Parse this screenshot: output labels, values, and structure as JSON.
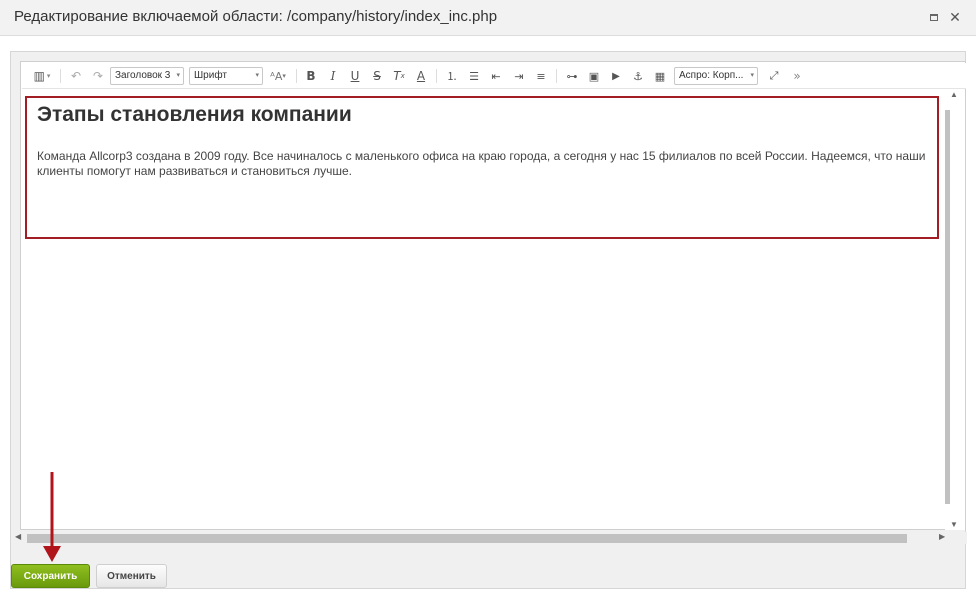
{
  "dialog": {
    "title": "Редактирование включаемой области: /company/history/index_inc.php"
  },
  "toolbar": {
    "format_select": "Заголовок 3",
    "font_select": "Шрифт",
    "style_select": "Аспро: Корп...",
    "icons": [
      "view-mode-icon",
      "undo-icon",
      "redo-icon",
      "font-size-icon",
      "bold-icon",
      "italic-icon",
      "underline-icon",
      "strikethrough-icon",
      "remove-format-icon",
      "font-color-icon",
      "ordered-list-icon",
      "unordered-list-icon",
      "outdent-icon",
      "indent-icon",
      "justify-icon",
      "link-icon",
      "image-icon",
      "video-icon",
      "anchor-icon",
      "table-icon",
      "fullscreen-icon",
      "more-icon"
    ]
  },
  "content": {
    "heading": "Этапы становления компании",
    "paragraph": "Команда Allcorp3 создана в 2009 году. Все начиналось с маленького офиса на краю города, а сегодня у нас 15 филиалов по всей России. Надеемся, что наши клиенты помогут нам развиваться и становиться лучше."
  },
  "buttons": {
    "save": "Сохранить",
    "cancel": "Отменить"
  },
  "colors": {
    "highlight_border": "#a31d24",
    "save_button": "#7aab14",
    "annotation_arrow": "#b0151b"
  }
}
